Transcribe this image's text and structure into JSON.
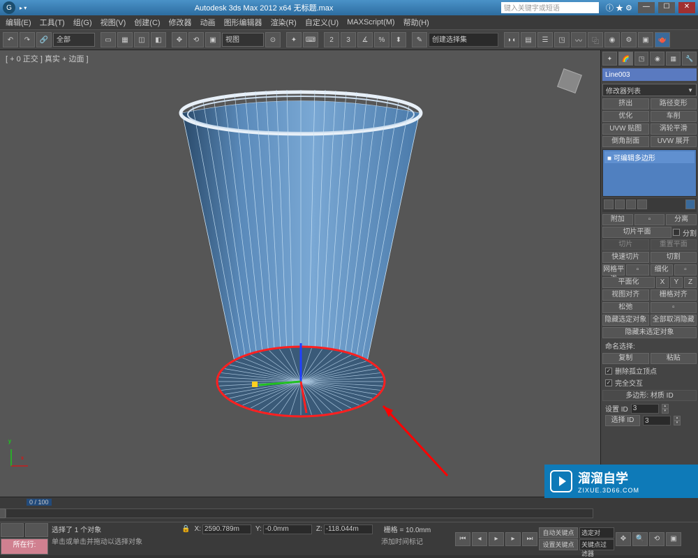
{
  "app": {
    "title": "Autodesk 3ds Max 2012 x64  无标题.max",
    "search_placeholder": "键入关键字或短语"
  },
  "menu": {
    "items": [
      "编辑(E)",
      "工具(T)",
      "组(G)",
      "视图(V)",
      "创建(C)",
      "修改器",
      "动画",
      "图形编辑器",
      "渲染(R)",
      "自定义(U)",
      "MAXScript(M)",
      "帮助(H)"
    ]
  },
  "toolbar": {
    "filter_all": "全部",
    "view_dd": "视图",
    "cmd_set": "创建选择集"
  },
  "viewport": {
    "label": "[ + 0 正交 ] 真实 + 边面 ]"
  },
  "cmdpanel": {
    "object_name": "Line003",
    "modlist_label": "修改器列表",
    "btns": {
      "extrude": "挤出",
      "path_deform": "路径变形",
      "optimize": "优化",
      "lathe": "车削",
      "uvw_map": "UVW 贴图",
      "turbosmooth": "涡轮平滑",
      "bevel_profile": "倒角剖面",
      "uvw_unwrap": "UVW 展开"
    },
    "stack_item": "可编辑多边形",
    "edit_poly_section": {
      "attach": "附加",
      "detach": "分离",
      "slice_plane": "切片平面",
      "split": "分割",
      "slice": "切片",
      "reset_plane": "重置平面",
      "quickslice": "快速切片",
      "cut": "切割",
      "msmooth": "网格平滑",
      "tessellate": "细化",
      "make_planar": "平面化",
      "x": "X",
      "y": "Y",
      "z": "Z",
      "view_align": "视图对齐",
      "grid_align": "栅格对齐",
      "relax": "松弛",
      "hide_sel": "隐藏选定对象",
      "unhide_all": "全部取消隐藏",
      "hide_unsel": "隐藏未选定对象",
      "named_sel": "命名选择:",
      "copy": "复制",
      "paste": "粘贴",
      "del_iso": "删除孤立顶点",
      "full_interact": "完全交互"
    },
    "poly_matid": {
      "title": "多边形: 材质 ID",
      "set_id": "设置 ID",
      "set_val": "3",
      "select_id": "选择 ID",
      "select_val": "3"
    }
  },
  "timeline": {
    "frame_indicator": "0 / 100"
  },
  "status": {
    "now_at": "所在行:",
    "sel_count": "选择了 1 个对象",
    "prompt": "单击或单击并拖动以选择对象",
    "add_time": "添加时间标记",
    "lock_icon": "🔒",
    "x_label": "X:",
    "x_val": "2590.789m",
    "y_label": "Y:",
    "y_val": "-0.0mm",
    "z_label": "Z:",
    "z_val": "-118.044m",
    "grid": "栅格 = 10.0mm",
    "autokey": "自动关键点",
    "selected": "选定对",
    "setkey": "设置关键点",
    "keyfilter": "关键点过滤器"
  },
  "watermark": {
    "brand": "溜溜自学",
    "url": "ZIXUE.3D66.COM"
  }
}
